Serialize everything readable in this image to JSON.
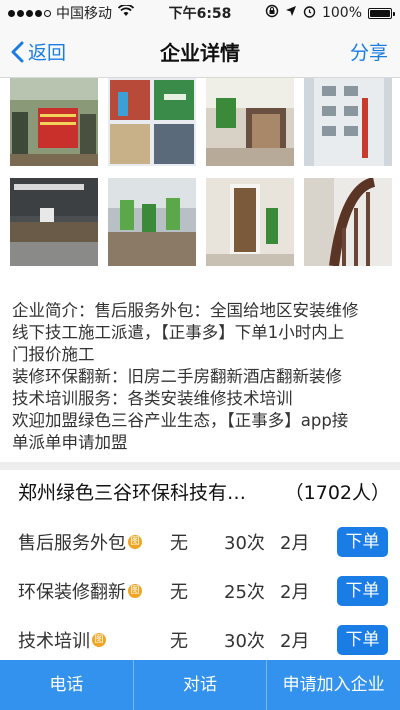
{
  "status": {
    "carrier": "中国移动",
    "time": "下午6:58",
    "battery": "100%"
  },
  "nav": {
    "back": "返回",
    "title": "企业详情",
    "share": "分享"
  },
  "intro": {
    "lines": [
      "企业简介：售后服务外包：全国给地区安装维修",
      "线下技工施工派遣，【正事多】下单1小时内上",
      "门报价施工",
      "装修环保翻新：旧房二手房翻新酒店翻新装修",
      "技术培训服务：各类安装维修技术培训",
      "欢迎加盟绿色三谷产业生态，【正事多】app接",
      "单派单申请加盟"
    ]
  },
  "company": {
    "name": "郑州绿色三谷环保科技有…",
    "members": "（1702人）"
  },
  "services": [
    {
      "name": "售后服务外包",
      "tag": "图",
      "status": "无",
      "times": "30次",
      "months": "2月",
      "action": "下单"
    },
    {
      "name": "环保装修翻新",
      "tag": "图",
      "status": "无",
      "times": "25次",
      "months": "2月",
      "action": "下单"
    },
    {
      "name": "技术培训",
      "tag": "图",
      "status": "无",
      "times": "30次",
      "months": "2月",
      "action": "下单"
    }
  ],
  "bottom": {
    "phone": "电话",
    "chat": "对话",
    "join": "申请加入企业"
  },
  "colors": {
    "accent": "#1a7de6",
    "bottom_bar": "#3292ee",
    "tag": "#f0a524"
  }
}
